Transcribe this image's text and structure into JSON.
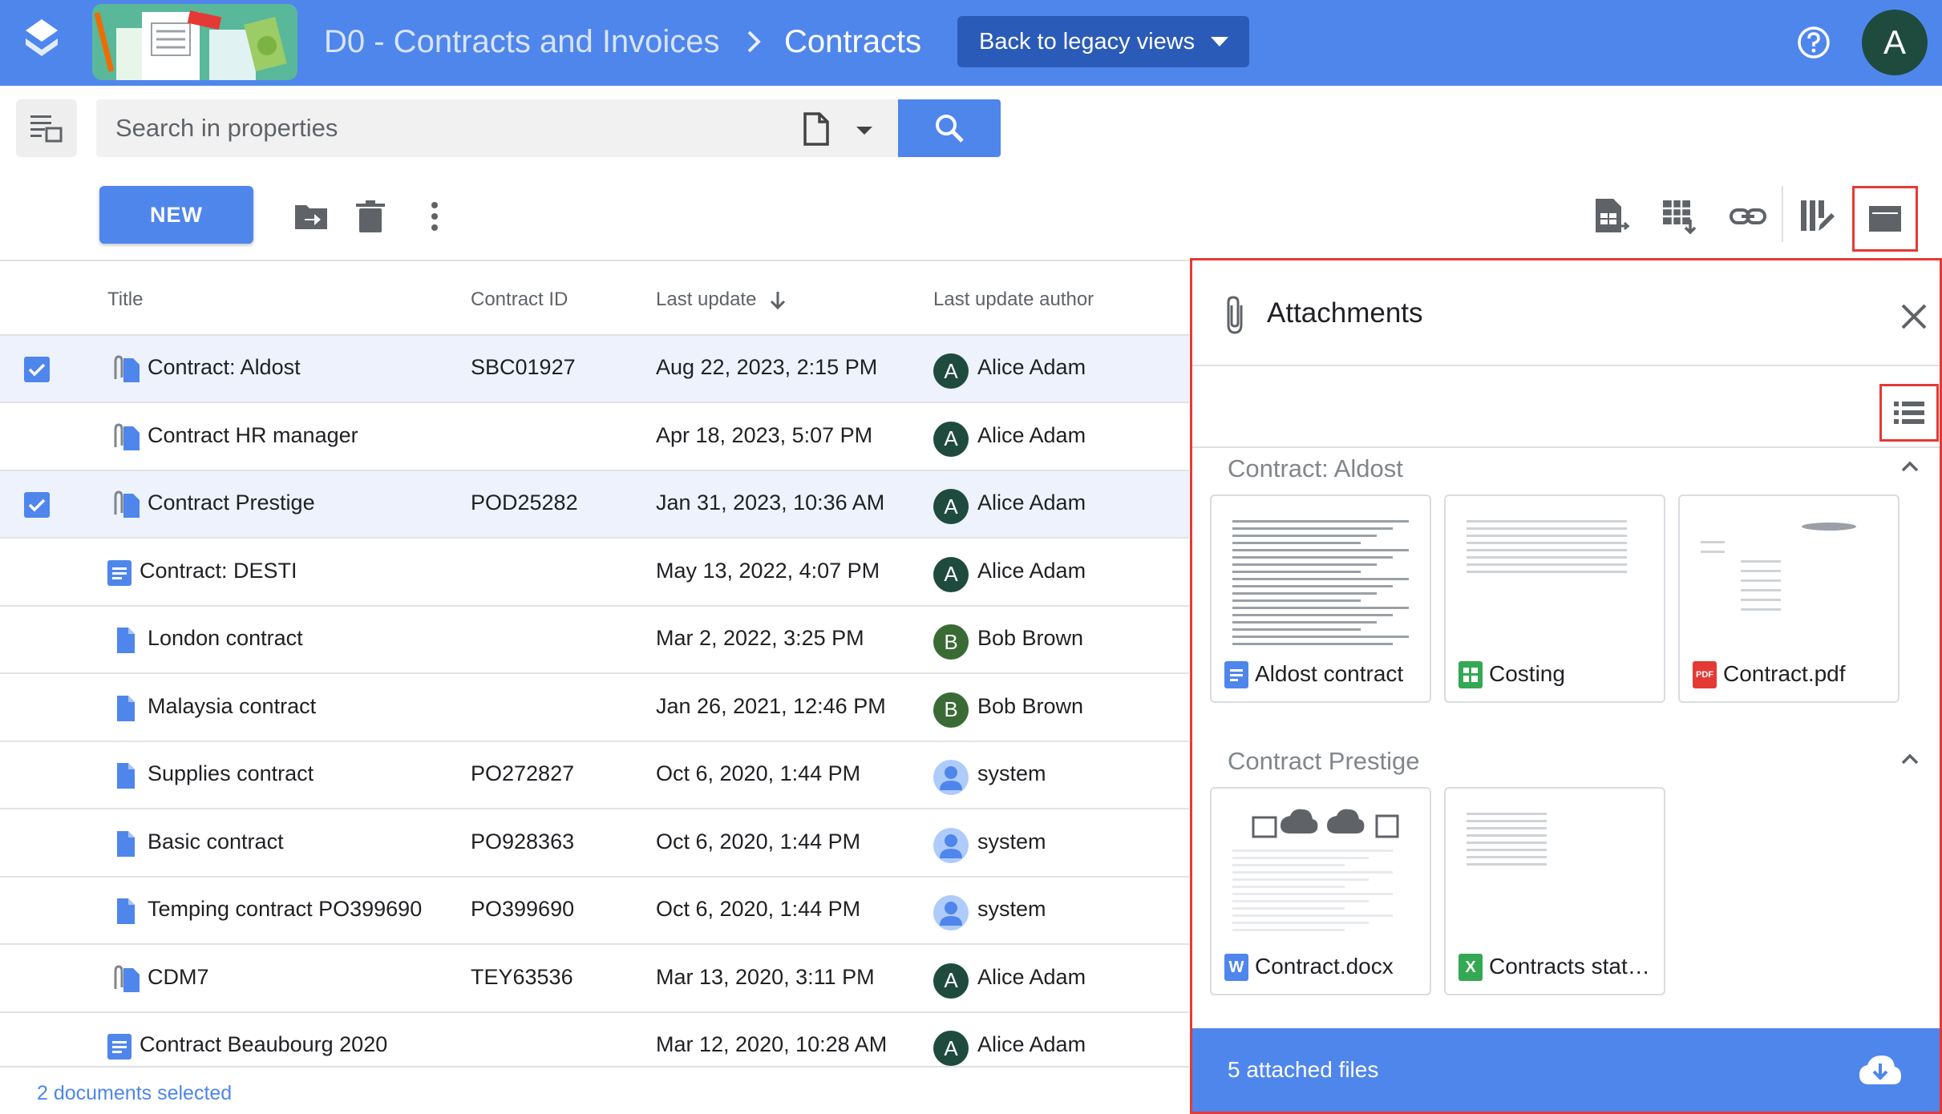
{
  "colors": {
    "primary": "#4f86ec",
    "dark_primary": "#2b5bb8",
    "avatar_green": "#1f4b3e",
    "avatar_bob": "#3a6b35",
    "highlight": "#e53935"
  },
  "header": {
    "breadcrumb_parent": "D0 - Contracts and Invoices",
    "breadcrumb_current": "Contracts",
    "legacy_button": "Back to legacy views",
    "user_initial": "A",
    "icons": [
      "app-logo-icon",
      "help-icon",
      "chevron-right-icon"
    ]
  },
  "search": {
    "placeholder": "Search in properties"
  },
  "actions": {
    "new_label": "NEW"
  },
  "table": {
    "columns": {
      "title": "Title",
      "contract_id": "Contract ID",
      "last_update": "Last update",
      "author": "Last update author"
    },
    "rows": [
      {
        "title": "Contract: Aldost",
        "id": "SBC01927",
        "date": "Aug 22, 2023, 2:15 PM",
        "author": "Alice Adam",
        "initial": "A",
        "selected": true,
        "icon": "attachment-doc-icon"
      },
      {
        "title": "Contract HR manager",
        "id": "",
        "date": "Apr 18, 2023, 5:07 PM",
        "author": "Alice Adam",
        "initial": "A",
        "selected": false,
        "icon": "attachment-doc-icon"
      },
      {
        "title": "Contract Prestige",
        "id": "POD25282",
        "date": "Jan 31, 2023, 10:36 AM",
        "author": "Alice Adam",
        "initial": "A",
        "selected": true,
        "icon": "attachment-doc-icon"
      },
      {
        "title": "Contract: DESTI",
        "id": "",
        "date": "May 13, 2022, 4:07 PM",
        "author": "Alice Adam",
        "initial": "A",
        "selected": false,
        "icon": "gdoc-icon"
      },
      {
        "title": "London contract",
        "id": "",
        "date": "Mar 2, 2022, 3:25 PM",
        "author": "Bob Brown",
        "initial": "B",
        "selected": false,
        "icon": "file-icon"
      },
      {
        "title": "Malaysia contract",
        "id": "",
        "date": "Jan 26, 2021, 12:46 PM",
        "author": "Bob Brown",
        "initial": "B",
        "selected": false,
        "icon": "file-icon"
      },
      {
        "title": "Supplies contract",
        "id": "PO272827",
        "date": "Oct 6, 2020, 1:44 PM",
        "author": "system",
        "initial": "",
        "selected": false,
        "icon": "file-icon"
      },
      {
        "title": "Basic contract",
        "id": "PO928363",
        "date": "Oct 6, 2020, 1:44 PM",
        "author": "system",
        "initial": "",
        "selected": false,
        "icon": "file-icon"
      },
      {
        "title": "Temping contract PO399690",
        "id": "PO399690",
        "date": "Oct 6, 2020, 1:44 PM",
        "author": "system",
        "initial": "",
        "selected": false,
        "icon": "file-icon"
      },
      {
        "title": "CDM7",
        "id": "TEY63536",
        "date": "Mar 13, 2020, 3:11 PM",
        "author": "Alice Adam",
        "initial": "A",
        "selected": false,
        "icon": "attachment-doc-icon"
      },
      {
        "title": "Contract Beaubourg 2020",
        "id": "",
        "date": "Mar 12, 2020, 10:28 AM",
        "author": "Alice Adam",
        "initial": "A",
        "selected": false,
        "icon": "gdoc-icon"
      }
    ],
    "status": "2 documents selected"
  },
  "attachments": {
    "title": "Attachments",
    "groups": [
      {
        "name": "Contract: Aldost",
        "files": [
          {
            "name": "Aldost contract",
            "type": "gdoc",
            "badge": ""
          },
          {
            "name": "Costing",
            "type": "gsheet",
            "badge": ""
          },
          {
            "name": "Contract.pdf",
            "type": "pdf",
            "badge": "PDF"
          }
        ]
      },
      {
        "name": "Contract Prestige",
        "files": [
          {
            "name": "Contract.docx",
            "type": "word",
            "badge": "W"
          },
          {
            "name": "Contracts stat…",
            "type": "excel",
            "badge": "X"
          }
        ]
      }
    ],
    "footer": "5 attached files"
  }
}
